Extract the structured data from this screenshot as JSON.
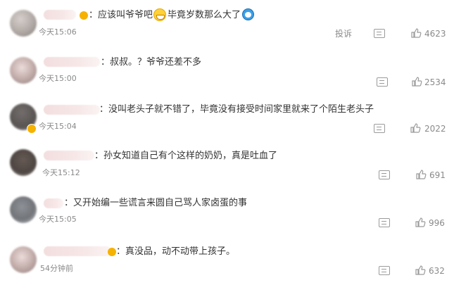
{
  "comments": [
    {
      "text_a": "：应该叫爷爷吧",
      "text_b": "毕竟岁数那么大了",
      "time": "今天15:06",
      "report": "投诉",
      "likes": "4623"
    },
    {
      "text": "：叔叔。？爷爷还差不多",
      "time": "今天15:00",
      "likes": "2534"
    },
    {
      "text": "：没叫老头子就不错了，毕竟没有接受时间家里就来了个陌生老头子",
      "time": "今天15:04",
      "likes": "2022"
    },
    {
      "text": "：孙女知道自己有个这样的奶奶，真是吐血了",
      "time": "今天15:12",
      "likes": "691"
    },
    {
      "text": "：又开始编一些谎言来圆自己骂人家卤蛋的事",
      "time": "今天15:05",
      "likes": "996"
    },
    {
      "text": "：真没品，动不动带上孩子。",
      "time": "54分钟前",
      "likes": "632"
    }
  ]
}
